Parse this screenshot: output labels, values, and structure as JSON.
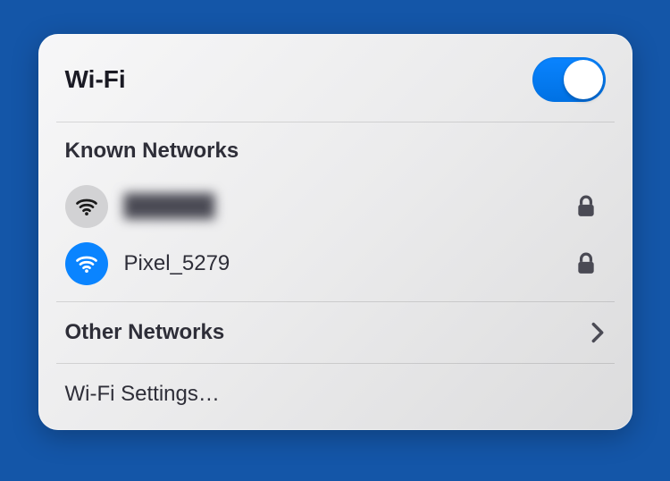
{
  "header": {
    "title": "Wi-Fi",
    "enabled": true
  },
  "known_networks": {
    "label": "Known Networks",
    "items": [
      {
        "name": "██████",
        "secured": true,
        "connected": false,
        "redacted": true
      },
      {
        "name": "Pixel_5279",
        "secured": true,
        "connected": true,
        "redacted": false
      }
    ]
  },
  "other_networks": {
    "label": "Other Networks"
  },
  "settings": {
    "label": "Wi-Fi Settings…"
  },
  "icons": {
    "wifi": "wifi-icon",
    "lock": "lock-icon",
    "chevron": "chevron-right-icon"
  }
}
